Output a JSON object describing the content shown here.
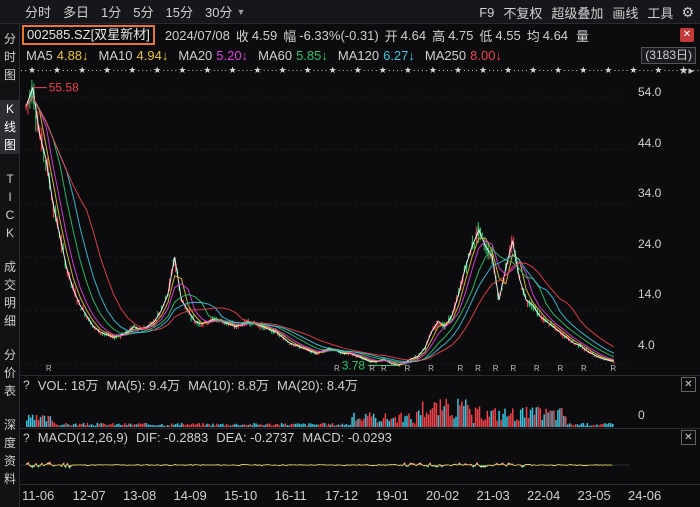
{
  "toolbar": {
    "periods": [
      "分时",
      "多日",
      "1分",
      "5分",
      "15分",
      "30分"
    ],
    "right": [
      "F9",
      "不复权",
      "超级叠加",
      "画线",
      "工具"
    ]
  },
  "sidebar": {
    "tabs": [
      "分时图",
      "K线图",
      "TICK",
      "成交明细",
      "分价表",
      "深度资料"
    ]
  },
  "info": {
    "code": "002585.SZ[双星新材]",
    "date": "2024/07/08",
    "close_label": "收",
    "close": "4.59",
    "change_label": "幅",
    "change": "-6.33%(-0.31)",
    "open_label": "开",
    "open": "4.64",
    "high_label": "高",
    "high": "4.75",
    "low_label": "低",
    "low": "4.55",
    "last_label": "均",
    "last": "4.64",
    "more": "量"
  },
  "ma": {
    "items": [
      {
        "label": "MA5",
        "value": "4.88↓",
        "color": "#e4c234"
      },
      {
        "label": "MA10",
        "value": "4.94↓",
        "color": "#e4c234"
      },
      {
        "label": "MA20",
        "value": "5.20↓",
        "color": "#e040e0"
      },
      {
        "label": "MA60",
        "value": "5.85↓",
        "color": "#2dc56a"
      },
      {
        "label": "MA120",
        "value": "6.27↓",
        "color": "#38c6e0"
      },
      {
        "label": "MA250",
        "value": "8.00↓",
        "color": "#f0424a"
      }
    ],
    "days": "(3183日)"
  },
  "chart_data": {
    "type": "line",
    "title": "",
    "xlabel": "",
    "ylabel": "",
    "ylim": [
      2,
      57
    ],
    "yticks": [
      "54.0",
      "44.0",
      "34.0",
      "24.0",
      "14.0",
      "4.0"
    ],
    "xticks": [
      "11-06",
      "12-07",
      "13-08",
      "14-09",
      "15-10",
      "16-11",
      "17-12",
      "19-01",
      "20-02",
      "21-03",
      "22-04",
      "23-05",
      "24-06"
    ],
    "annotations": {
      "high": "55.58",
      "low": "3.78"
    },
    "series": [
      {
        "values": [
          52,
          55.58,
          47,
          42,
          34,
          28,
          22,
          18,
          15,
          13,
          11,
          10,
          9.5,
          9,
          9.5,
          10,
          11,
          10.5,
          11,
          12,
          14,
          17,
          24,
          16,
          14,
          12,
          11.5,
          12,
          12.5,
          12,
          11.5,
          11,
          11.5,
          12,
          11.5,
          11,
          10.5,
          10,
          9,
          8,
          7.5,
          7,
          6.5,
          6,
          6.5,
          7,
          6.5,
          6,
          6,
          5.5,
          5,
          4.5,
          4.5,
          5,
          4.2,
          3.78,
          4.3,
          5,
          5.5,
          7,
          10,
          12,
          11,
          13,
          17,
          22,
          26,
          29,
          26,
          24,
          16,
          22,
          27,
          20,
          16,
          15,
          13,
          12,
          11,
          10,
          9,
          8,
          7.5,
          6.5,
          5.8,
          5.2,
          4.8,
          4.59
        ]
      }
    ]
  },
  "volume": {
    "label": "VOL: 18万",
    "ma5_label": "MA(5): 9.4万",
    "ma10_label": "MA(10): 8.8万",
    "ma20_label": "MA(20): 8.4万",
    "ytick": "0"
  },
  "macd": {
    "label": "MACD(12,26,9)",
    "dif_label": "DIF: -0.2883",
    "dea_label": "DEA: -0.2737",
    "macd_label": "MACD: -0.0293"
  }
}
